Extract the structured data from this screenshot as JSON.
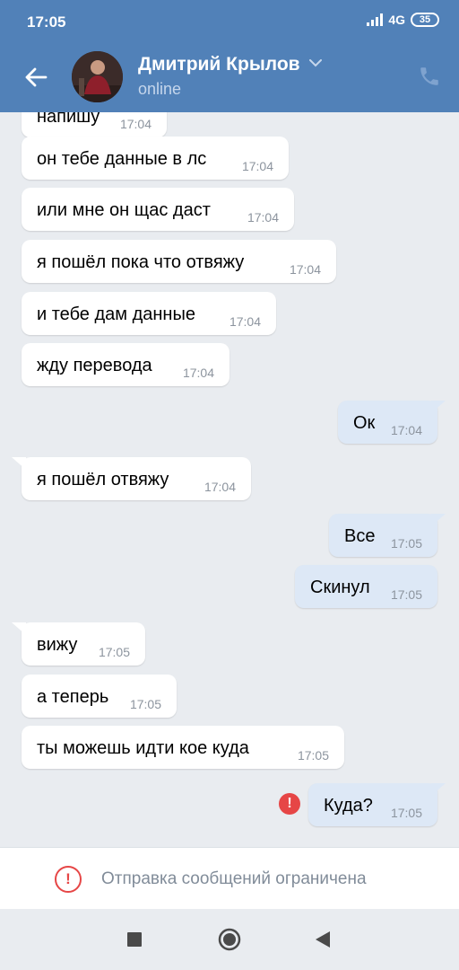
{
  "status_bar": {
    "time": "17:05",
    "network": "4G",
    "battery": "35"
  },
  "header": {
    "contact_name": "Дмитрий Крылов",
    "contact_status": "online"
  },
  "messages": [
    {
      "text": "напишу",
      "time": "17:04",
      "dir": "in"
    },
    {
      "text": "он тебе данные в лс",
      "time": "17:04",
      "dir": "in"
    },
    {
      "text": "или мне он щас даст",
      "time": "17:04",
      "dir": "in"
    },
    {
      "text": "я пошёл пока что отвяжу",
      "time": "17:04",
      "dir": "in"
    },
    {
      "text": "и тебе дам данные",
      "time": "17:04",
      "dir": "in"
    },
    {
      "text": "жду перевода",
      "time": "17:04",
      "dir": "in"
    },
    {
      "text": "Ок",
      "time": "17:04",
      "dir": "out"
    },
    {
      "text": "я пошёл отвяжу",
      "time": "17:04",
      "dir": "in"
    },
    {
      "text": "Все",
      "time": "17:05",
      "dir": "out"
    },
    {
      "text": "Скинул",
      "time": "17:05",
      "dir": "out"
    },
    {
      "text": "вижу",
      "time": "17:05",
      "dir": "in"
    },
    {
      "text": "а теперь",
      "time": "17:05",
      "dir": "in"
    },
    {
      "text": "ты можешь идти кое куда",
      "time": "17:05",
      "dir": "in"
    },
    {
      "text": "Куда?",
      "time": "17:05",
      "dir": "out",
      "failed": true
    }
  ],
  "restriction": {
    "text": "Отправка сообщений ограничена"
  },
  "colors": {
    "header": "#5181b8",
    "incoming": "#ffffff",
    "outgoing": "#dde8f6",
    "error": "#e64646",
    "background": "#e9ecf0"
  },
  "icons": {
    "back": "arrow-left-icon",
    "call": "phone-icon",
    "dropdown": "chevron-down-icon",
    "error": "exclamation-icon",
    "nav": [
      "square-icon",
      "circle-icon",
      "triangle-back-icon"
    ]
  }
}
